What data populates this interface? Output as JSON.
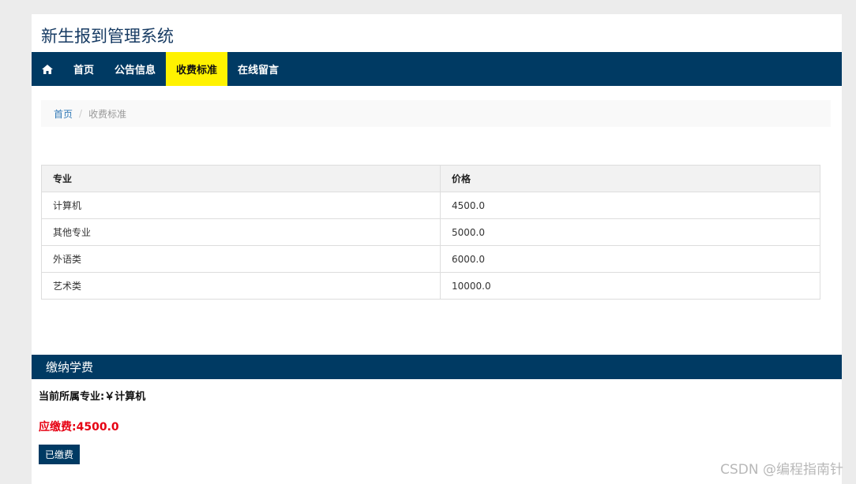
{
  "site": {
    "title": "新生报到管理系统"
  },
  "nav": {
    "home_icon": "home-icon",
    "items": [
      {
        "label": "首页",
        "active": false
      },
      {
        "label": "公告信息",
        "active": false
      },
      {
        "label": "收费标准",
        "active": true
      },
      {
        "label": "在线留言",
        "active": false
      }
    ]
  },
  "breadcrumb": {
    "home": "首页",
    "separator": "/",
    "current": "收费标准"
  },
  "fee_table": {
    "headers": [
      "专业",
      "价格"
    ],
    "rows": [
      [
        "计算机",
        "4500.0"
      ],
      [
        "其他专业",
        "5000.0"
      ],
      [
        "外语类",
        "6000.0"
      ],
      [
        "艺术类",
        "10000.0"
      ]
    ]
  },
  "payment": {
    "header": "缴纳学费",
    "current_major": "当前所属专业:￥计算机",
    "amount_due": "应缴费:4500.0",
    "paid_button": "已缴费"
  },
  "watermark": "CSDN @编程指南针",
  "colors": {
    "nav_bg": "#003a63",
    "active_tab": "#fff200",
    "due_text": "#e60012"
  }
}
